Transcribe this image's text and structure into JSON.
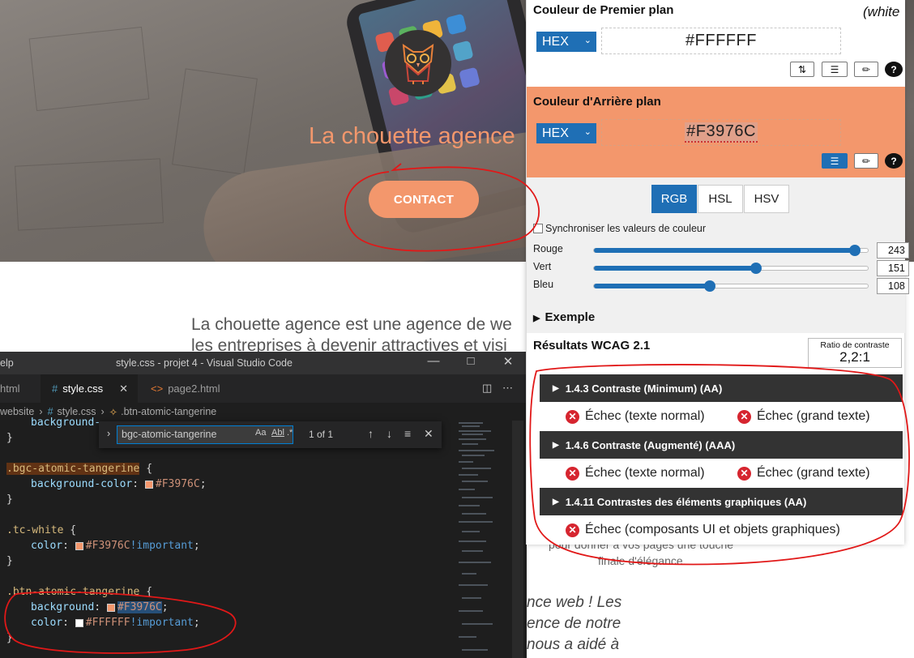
{
  "website": {
    "hero_title": "La chouette agence",
    "contact_button": "CONTACT",
    "body_line1": "La chouette agence est une agence de we",
    "body_line2": "les entreprises à devenir attractives et visi",
    "side_line1": "nce web ! Les",
    "side_line2": "ence de notre",
    "side_line3": "nous a aidé à",
    "under_line1": "pour donner à vos pages une touche",
    "under_line2": "finale d'élégance."
  },
  "vscode": {
    "menu_fragment": "elp",
    "window_title": "style.css - projet 4 - Visual Studio Code",
    "tabs": [
      {
        "label": "html",
        "active": false
      },
      {
        "label": "style.css",
        "active": true
      },
      {
        "label": "page2.html",
        "active": false
      }
    ],
    "breadcrumb": {
      "folder": "website",
      "file": "style.css",
      "symbol": ".btn-atomic-tangerine"
    },
    "find": {
      "query": "bgc-atomic-tangerine",
      "opt_case": "Aa",
      "opt_word": "Abl",
      "opt_regex": ".*",
      "count": "1 of 1"
    },
    "code": {
      "l1_prop": "background-",
      "close": "}",
      "sel_bgc": ".bgc-atomic-tangerine",
      "open": " {",
      "prop_bg": "background-color",
      "colon": ": ",
      "val_f3976c": "#F3976C",
      "semi": ";",
      "sel_tc": ".tc-white",
      "prop_color": "color",
      "important": "!important",
      "sel_btn": ".btn-atomic-tangerine",
      "prop_background": "background",
      "val_ffffff": "#FFFFFF"
    }
  },
  "panel": {
    "fg_title": "Couleur de Premier plan",
    "fg_note": "(white",
    "fg_format": "HEX",
    "fg_value": "#FFFFFF",
    "bg_title": "Couleur d'Arrière plan",
    "bg_format": "HEX",
    "bg_value": "#F3976C",
    "modes": [
      "RGB",
      "HSL",
      "HSV"
    ],
    "active_mode": "RGB",
    "sync_label": "Synchroniser les valeurs de couleur",
    "sliders": [
      {
        "label": "Rouge",
        "value": "243",
        "fraction": 0.953
      },
      {
        "label": "Vert",
        "value": "151",
        "fraction": 0.592
      },
      {
        "label": "Bleu",
        "value": "108",
        "fraction": 0.424
      }
    ],
    "exemple_label": "Exemple",
    "wcag_title": "Résultats WCAG 2.1",
    "ratio_label": "Ratio de contraste",
    "ratio_value": "2,2:1",
    "criteria": [
      {
        "title": "1.4.3 Contraste (Minimum) (AA)",
        "results": [
          "Échec (texte normal)",
          "Échec (grand texte)"
        ]
      },
      {
        "title": "1.4.6 Contraste (Augmenté) (AAA)",
        "results": [
          "Échec (texte normal)",
          "Échec (grand texte)"
        ]
      },
      {
        "title": "1.4.11 Contrastes des éléments graphiques (AA)",
        "results": [
          "Échec (composants UI et objets graphiques)"
        ]
      }
    ]
  },
  "colors": {
    "tangerine": "#F3976C",
    "panel_blue": "#1f6fb5",
    "fail_red": "#d6252f",
    "annotation_red": "#e11818"
  }
}
